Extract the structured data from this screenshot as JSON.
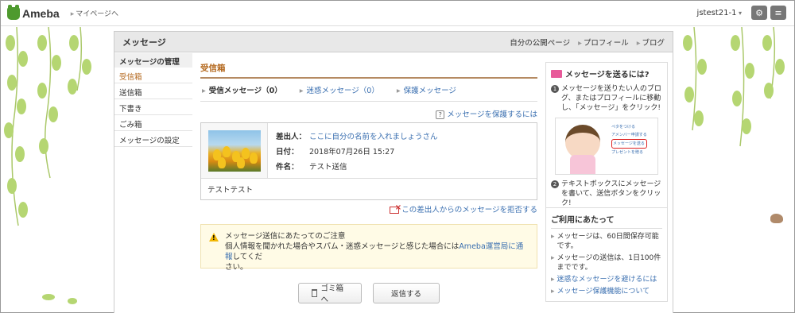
{
  "topbar": {
    "logo": "Ameba",
    "mypage": "マイページへ",
    "username": "jstest21-1",
    "gear_icon": "gear-icon",
    "menu_icon": "menu-icon"
  },
  "header": {
    "title": "メッセージ",
    "links": [
      "自分の公開ページ",
      "プロフィール",
      "ブログ"
    ]
  },
  "leftnav": {
    "heading": "メッセージの管理",
    "items": [
      "受信箱",
      "送信箱",
      "下書き",
      "ごみ箱",
      "メッセージの設定"
    ]
  },
  "main": {
    "section_title": "受信箱",
    "tabs": [
      "受信メッセージ（0）",
      "迷惑メッセージ（0）",
      "保護メッセージ"
    ],
    "protect_link": "メッセージを保護するには",
    "message": {
      "from_label": "差出人：",
      "from_value": "ここに自分の名前を入れましょうさん",
      "date_label": "日付：",
      "date_value": "2018年07月26日 15:27",
      "subject_label": "件名：",
      "subject_value": "テスト送信",
      "body": "テストテスト"
    },
    "reject_link": "この差出人からのメッセージを拒否する",
    "notice": {
      "title": "メッセージ送信にあたってのご注意",
      "text_before": "個人情報を聞かれた場合やスパム・迷惑メッセージと感じた場合には",
      "link": "Ameba運営局に通報",
      "text_after": "してくだ",
      "text_last": "さい。"
    },
    "buttons": {
      "trash": "ゴミ箱へ",
      "reply": "返信する"
    }
  },
  "sidebar": {
    "howto_title": "メッセージを送るには?",
    "step1": "メッセージを送りたい人のブログ、またはプロフィールに移動し、「メッセージ」をクリック!",
    "mini_menu": [
      "ペタをつける",
      "アメンバー申請する",
      "メッセージを送る",
      "プレゼントを贈る"
    ],
    "step2": "テキストボックスにメッセージを書いて、送信ボタンをクリック!",
    "usage_title": "ご利用にあたって",
    "usage_items": [
      "メッセージは、60日間保存可能です。",
      "メッセージの送信は、1日100件までです。",
      "迷惑なメッセージを避けるには",
      "メッセージ保護機能について"
    ]
  }
}
